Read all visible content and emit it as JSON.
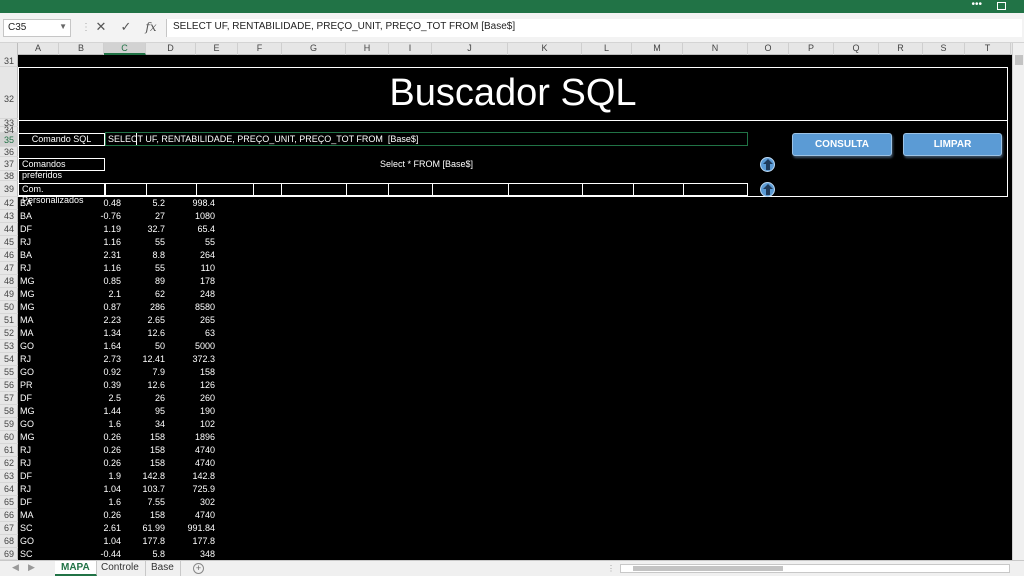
{
  "window": {
    "menu_dots": "•••"
  },
  "formula_bar": {
    "name_box": "C35",
    "cancel_symbol": "✕",
    "enter_symbol": "✓",
    "fx_label": "fx",
    "formula": "SELECT UF, RENTABILIDADE, PREÇO_UNIT, PREÇO_TOT FROM  [Base$]"
  },
  "columns": [
    "A",
    "B",
    "C",
    "D",
    "E",
    "F",
    "G",
    "H",
    "I",
    "J",
    "K",
    "L",
    "M",
    "N",
    "O",
    "P",
    "Q",
    "R",
    "S",
    "T"
  ],
  "rows": [
    "31",
    "32",
    "33",
    "34",
    "35",
    "36",
    "37",
    "38",
    "39",
    "42",
    "43",
    "44",
    "45",
    "46",
    "47",
    "48",
    "49",
    "50",
    "51",
    "52",
    "53",
    "54",
    "55",
    "56",
    "57",
    "58",
    "59",
    "60",
    "61",
    "62",
    "63",
    "64",
    "65",
    "66",
    "67",
    "68",
    "69"
  ],
  "panel": {
    "title": "Buscador SQL",
    "label_sql": "Comando SQL",
    "label_pref": "Comandos preferidos",
    "label_pers": "Com. Personalizados",
    "sql_select": "SELECT",
    "sql_rest": " UF, RENTABILIDADE, PREÇO_UNIT, PREÇO_TOT FROM  [Base$]",
    "pref_text": "Select * FROM [Base$]",
    "consulta_label": "CONSULTA",
    "limpar_label": "LIMPAR"
  },
  "data_rows": [
    [
      "BA",
      "0.48",
      "5.2",
      "998.4"
    ],
    [
      "BA",
      "-0.76",
      "27",
      "1080"
    ],
    [
      "DF",
      "1.19",
      "32.7",
      "65.4"
    ],
    [
      "RJ",
      "1.16",
      "55",
      "55"
    ],
    [
      "BA",
      "2.31",
      "8.8",
      "264"
    ],
    [
      "RJ",
      "1.16",
      "55",
      "110"
    ],
    [
      "MG",
      "0.85",
      "89",
      "178"
    ],
    [
      "MG",
      "2.1",
      "62",
      "248"
    ],
    [
      "MG",
      "0.87",
      "286",
      "8580"
    ],
    [
      "MA",
      "2.23",
      "2.65",
      "265"
    ],
    [
      "MA",
      "1.34",
      "12.6",
      "63"
    ],
    [
      "GO",
      "1.64",
      "50",
      "5000"
    ],
    [
      "RJ",
      "2.73",
      "12.41",
      "372.3"
    ],
    [
      "GO",
      "0.92",
      "7.9",
      "158"
    ],
    [
      "PR",
      "0.39",
      "12.6",
      "126"
    ],
    [
      "DF",
      "2.5",
      "26",
      "260"
    ],
    [
      "MG",
      "1.44",
      "95",
      "190"
    ],
    [
      "GO",
      "1.6",
      "34",
      "102"
    ],
    [
      "MG",
      "0.26",
      "158",
      "1896"
    ],
    [
      "RJ",
      "0.26",
      "158",
      "4740"
    ],
    [
      "RJ",
      "0.26",
      "158",
      "4740"
    ],
    [
      "DF",
      "1.9",
      "142.8",
      "142.8"
    ],
    [
      "RJ",
      "1.04",
      "103.7",
      "725.9"
    ],
    [
      "DF",
      "1.6",
      "7.55",
      "302"
    ],
    [
      "MA",
      "0.26",
      "158",
      "4740"
    ],
    [
      "SC",
      "2.61",
      "61.99",
      "991.84"
    ],
    [
      "GO",
      "1.04",
      "177.8",
      "177.8"
    ],
    [
      "SC",
      "-0.44",
      "5.8",
      "348"
    ]
  ],
  "tabs": [
    "MAPA",
    "Controle",
    "Base"
  ],
  "tab_add": "+",
  "colors": {
    "accent": "#217346",
    "button": "#5b9bd5"
  }
}
